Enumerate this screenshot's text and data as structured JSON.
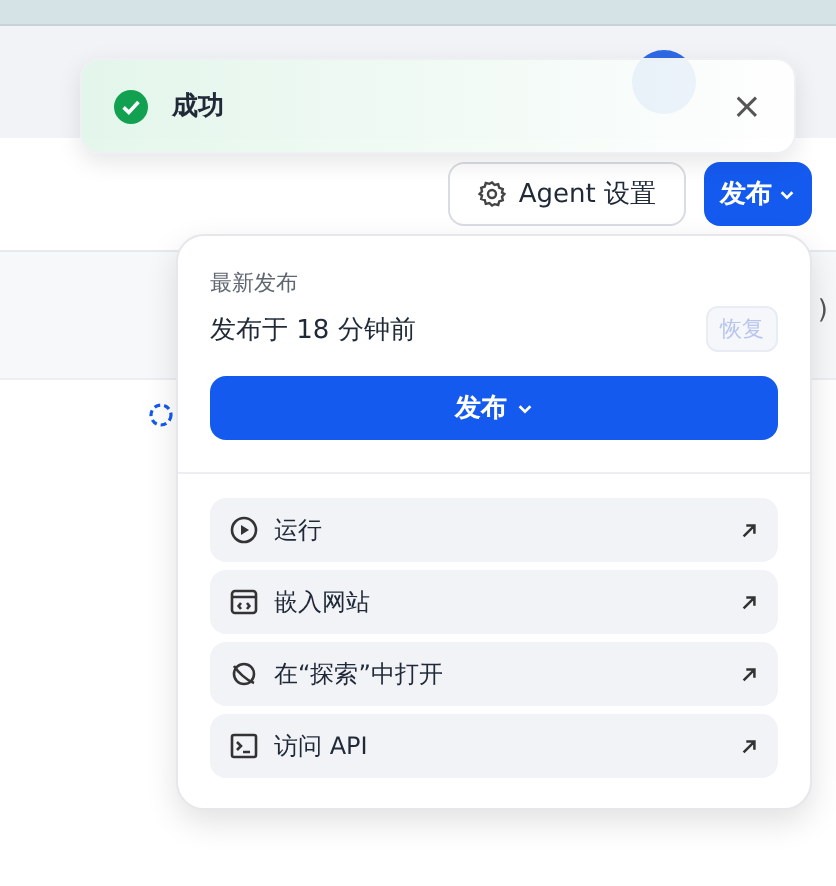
{
  "background": {
    "fragment": ")"
  },
  "toast": {
    "message": "成功",
    "close": "×"
  },
  "toolbar": {
    "settings": "Agent 设置",
    "publish": "发布"
  },
  "popover": {
    "heading": "最新发布",
    "published": "发布于 18 分钟前",
    "restore": {
      "label": "恢复",
      "disabled": true
    },
    "publish": "发布",
    "items": [
      {
        "kind": "run",
        "label": "运行"
      },
      {
        "kind": "embed",
        "label": "嵌入网站"
      },
      {
        "kind": "explore",
        "label": "在“探索”中打开"
      },
      {
        "kind": "api",
        "label": "访问 API"
      }
    ]
  }
}
